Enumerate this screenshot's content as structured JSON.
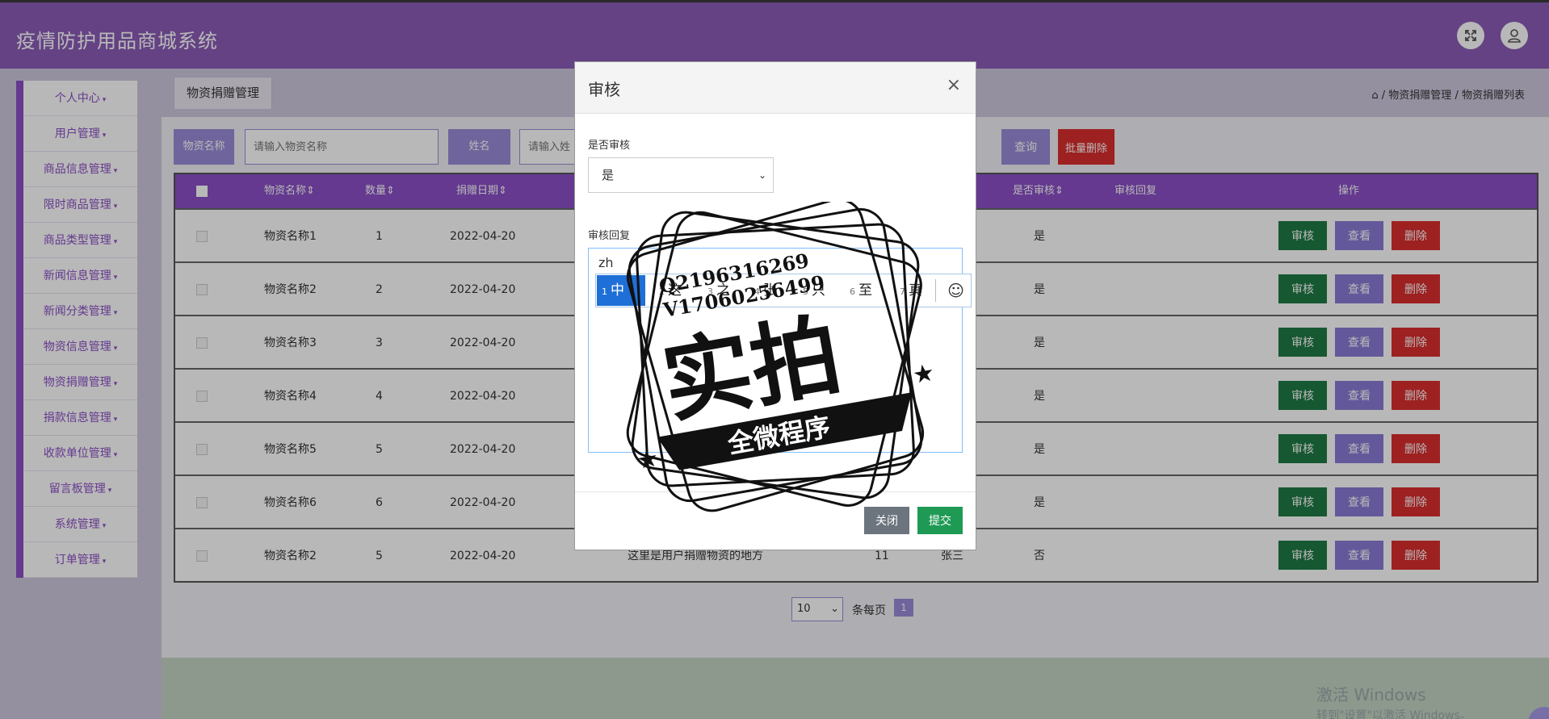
{
  "app": {
    "title": "疫情防护用品商城系统"
  },
  "header": {
    "fullscreen_icon": "expand-icon",
    "user_icon": "user-icon"
  },
  "sidebar": {
    "items": [
      {
        "label": "个人中心"
      },
      {
        "label": "用户管理"
      },
      {
        "label": "商品信息管理"
      },
      {
        "label": "限时商品管理"
      },
      {
        "label": "商品类型管理"
      },
      {
        "label": "新闻信息管理"
      },
      {
        "label": "新闻分类管理"
      },
      {
        "label": "物资信息管理"
      },
      {
        "label": "物资捐赠管理"
      },
      {
        "label": "捐款信息管理"
      },
      {
        "label": "收款单位管理"
      },
      {
        "label": "留言板管理"
      },
      {
        "label": "系统管理"
      },
      {
        "label": "订单管理"
      }
    ]
  },
  "tab": {
    "label": "物资捐赠管理"
  },
  "breadcrumb": {
    "level1": "物资捐赠管理",
    "level2": "物资捐赠列表",
    "separator": "/"
  },
  "search": {
    "name_label": "物资名称",
    "name_placeholder": "请输入物资名称",
    "person_label": "姓名",
    "person_placeholder": "请输入姓",
    "query_label": "查询",
    "batch_delete_label": "批量删除"
  },
  "table": {
    "headers": {
      "name": "物资名称",
      "qty": "数量",
      "date": "捐赠日期",
      "audited": "是否审核",
      "reply": "审核回复",
      "ops": "操作"
    },
    "rows": [
      {
        "name": "物资名称1",
        "qty": "1",
        "date": "2022-04-20",
        "audited": "是"
      },
      {
        "name": "物资名称2",
        "qty": "2",
        "date": "2022-04-20",
        "audited": "是"
      },
      {
        "name": "物资名称3",
        "qty": "3",
        "date": "2022-04-20",
        "audited": "是"
      },
      {
        "name": "物资名称4",
        "qty": "4",
        "date": "2022-04-20",
        "audited": "是"
      },
      {
        "name": "物资名称5",
        "qty": "5",
        "date": "2022-04-20",
        "audited": "是"
      },
      {
        "name": "物资名称6",
        "qty": "6",
        "date": "2022-04-20",
        "audited": "是"
      },
      {
        "name": "物资名称2",
        "qty": "5",
        "date": "2022-04-20",
        "audited": "否",
        "remark": "这里是用户捐赠物资的地方",
        "count": "11",
        "person": "张三"
      }
    ],
    "op_audit": "审核",
    "op_view": "查看",
    "op_delete": "删除"
  },
  "pager": {
    "page_size": "10",
    "per_page_text": "条每页",
    "current_page": "1"
  },
  "modal": {
    "title": "审核",
    "close_symbol": "×",
    "audited_label": "是否审核",
    "audited_value": "是",
    "reply_label": "审核回复",
    "reply_value": "zh",
    "close_button": "关闭",
    "submit_button": "提交"
  },
  "ime": {
    "candidates": [
      {
        "n": "1",
        "text": "中"
      },
      {
        "n": "2",
        "text": "这"
      },
      {
        "n": "3",
        "text": "之"
      },
      {
        "n": "4",
        "text": "张"
      },
      {
        "n": "5",
        "text": "只"
      },
      {
        "n": "6",
        "text": "至"
      },
      {
        "n": "7",
        "text": "真"
      }
    ],
    "emoji_icon": "smiley-icon"
  },
  "stamp": {
    "line1": "Q2196316269",
    "line2": "V17060256499",
    "main": "实拍",
    "banner": "全微程序"
  },
  "windows_watermark": {
    "line1": "激活 Windows",
    "line2": "转到\"设置\"以激活 Windows。"
  },
  "colors": {
    "header": "#8b5cb8",
    "accent": "#8b4fc6",
    "label_bg": "#9a8cd8",
    "danger": "#dc2f2f",
    "success": "#1f7a45",
    "submit": "#1f9a55",
    "ime_active": "#1f6fd8"
  }
}
